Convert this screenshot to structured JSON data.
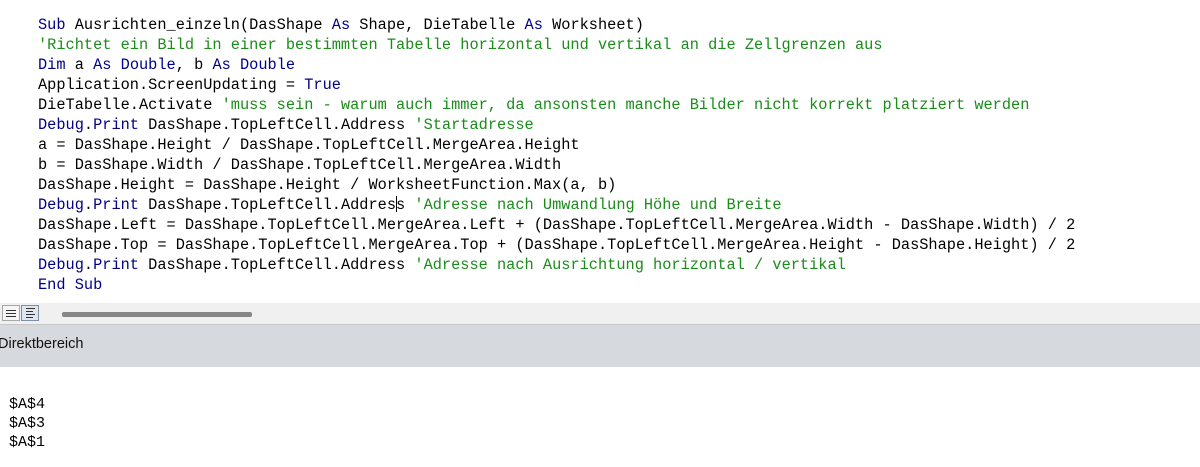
{
  "code_editor": {
    "lines": [
      [
        {
          "t": "Sub",
          "c": "kw"
        },
        {
          "t": " Ausrichten_einzeln(DasShape "
        },
        {
          "t": "As",
          "c": "kw"
        },
        {
          "t": " Shape, DieTabelle "
        },
        {
          "t": "As",
          "c": "kw"
        },
        {
          "t": " Worksheet)"
        }
      ],
      [
        {
          "t": "'Richtet ein Bild in einer bestimmten Tabelle horizontal und vertikal an die Zellgrenzen aus",
          "c": "cm"
        }
      ],
      [
        {
          "t": "Dim",
          "c": "kw"
        },
        {
          "t": " a "
        },
        {
          "t": "As",
          "c": "kw"
        },
        {
          "t": " "
        },
        {
          "t": "Double",
          "c": "kw"
        },
        {
          "t": ", b "
        },
        {
          "t": "As",
          "c": "kw"
        },
        {
          "t": " "
        },
        {
          "t": "Double",
          "c": "kw"
        }
      ],
      [
        {
          "t": "Application.ScreenUpdating = "
        },
        {
          "t": "True",
          "c": "kw"
        }
      ],
      [
        {
          "t": "DieTabelle.Activate "
        },
        {
          "t": "'muss sein - warum auch immer, da ansonsten manche Bilder nicht korrekt platziert werden",
          "c": "cm"
        }
      ],
      [
        {
          "t": "Debug",
          "c": "kw"
        },
        {
          "t": "."
        },
        {
          "t": "Print",
          "c": "kw"
        },
        {
          "t": " DasShape.TopLeftCell.Address "
        },
        {
          "t": "'Startadresse",
          "c": "cm"
        }
      ],
      [
        {
          "t": "a = DasShape.Height / DasShape.TopLeftCell.MergeArea.Height"
        }
      ],
      [
        {
          "t": "b = DasShape.Width / DasShape.TopLeftCell.MergeArea.Width"
        }
      ],
      [
        {
          "t": "DasShape.Height = DasShape.Height / WorksheetFunction.Max(a, b)"
        }
      ],
      [
        {
          "t": "Debug",
          "c": "kw"
        },
        {
          "t": "."
        },
        {
          "t": "Print",
          "c": "kw"
        },
        {
          "t": " DasShape.TopLeftCell.Addres"
        },
        {
          "cursor": true
        },
        {
          "t": "s "
        },
        {
          "t": "'Adresse nach Umwandlung Höhe und Breite",
          "c": "cm"
        }
      ],
      [
        {
          "t": "DasShape.Left = DasShape.TopLeftCell.MergeArea.Left + (DasShape.TopLeftCell.MergeArea.Width - DasShape.Width) / 2"
        }
      ],
      [
        {
          "t": "DasShape.Top = DasShape.TopLeftCell.MergeArea.Top + (DasShape.TopLeftCell.MergeArea.Height - DasShape.Height) / 2"
        }
      ],
      [
        {
          "t": "Debug",
          "c": "kw"
        },
        {
          "t": "."
        },
        {
          "t": "Print",
          "c": "kw"
        },
        {
          "t": " DasShape.TopLeftCell.Address "
        },
        {
          "t": "'Adresse nach Ausrichtung horizontal / vertikal",
          "c": "cm"
        }
      ],
      [
        {
          "t": "End Sub",
          "c": "kw"
        }
      ]
    ]
  },
  "colors": {
    "keyword": "#00008b",
    "comment": "#1a8c1a",
    "text": "#000000",
    "panel_header": "#d6d9dd"
  },
  "view_buttons": [
    {
      "icon": "procedure-view-icon",
      "active": false
    },
    {
      "icon": "full-module-view-icon",
      "active": true
    }
  ],
  "immediate_window": {
    "title": "Direktbereich",
    "output": [
      "$A$4",
      "$A$3",
      "$A$1"
    ]
  }
}
